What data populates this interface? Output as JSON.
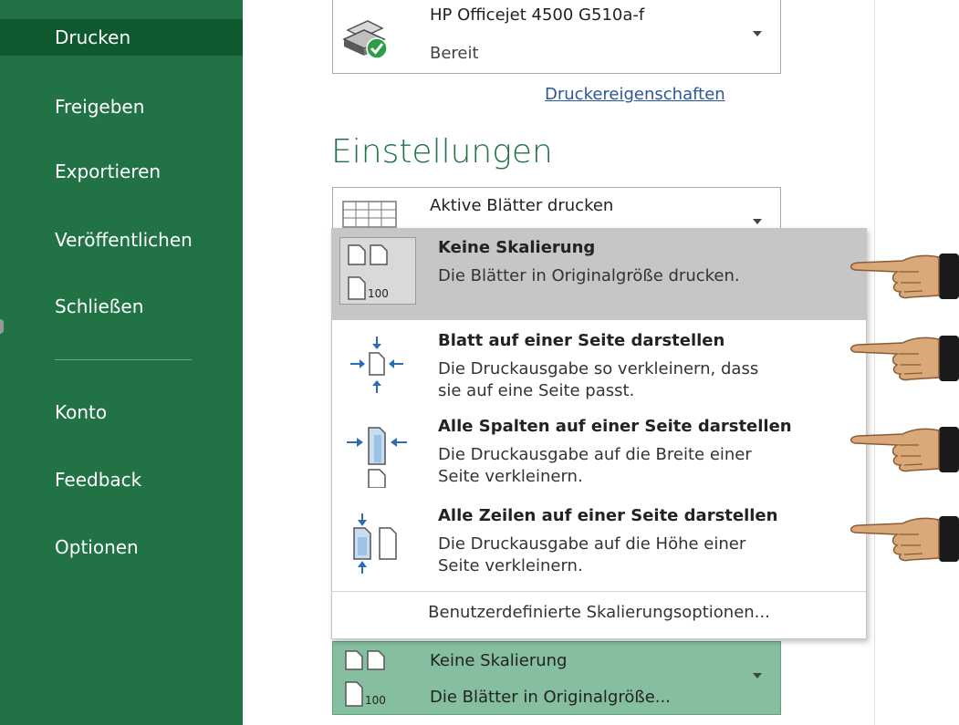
{
  "sidebar": {
    "items": [
      {
        "label": "Drucken",
        "active": true
      },
      {
        "label": "Freigeben"
      },
      {
        "label": "Exportieren"
      },
      {
        "label": "Veröffentlichen"
      },
      {
        "label": "Schließen"
      },
      {
        "label": "Konto"
      },
      {
        "label": "Feedback"
      },
      {
        "label": "Optionen"
      }
    ]
  },
  "printer": {
    "name": "HP Officejet 4500 G510a-f",
    "status": "Bereit",
    "icon": "printer-ready-icon",
    "properties_link": "Druckereigenschaften"
  },
  "settings": {
    "title": "Einstellungen",
    "sheets_selector": {
      "label": "Aktive Blätter drucken",
      "icon": "sheet-grid-icon"
    }
  },
  "scaling_menu": {
    "options": [
      {
        "title": "Keine Skalierung",
        "desc1": "Die Blätter in Originalgröße drucken.",
        "desc2": "",
        "icon": "no-scaling-icon",
        "icon_text": "100",
        "selected": true
      },
      {
        "title": "Blatt auf einer Seite darstellen",
        "desc1": "Die Druckausgabe so verkleinern, dass",
        "desc2": "sie auf eine Seite passt.",
        "icon": "fit-sheet-icon"
      },
      {
        "title": "Alle Spalten auf einer Seite darstellen",
        "desc1": "Die Druckausgabe auf die Breite einer",
        "desc2": "Seite verkleinern.",
        "icon": "fit-columns-icon"
      },
      {
        "title": "Alle Zeilen auf einer Seite darstellen",
        "desc1": "Die Druckausgabe auf die Höhe einer",
        "desc2": "Seite verkleinern.",
        "icon": "fit-rows-icon"
      }
    ],
    "custom_option": "Benutzerdefinierte Skalierungsoptionen..."
  },
  "scaling_selector": {
    "title": "Keine Skalierung",
    "desc": "Die Blätter in Originalgröße...",
    "icon": "no-scaling-icon",
    "icon_text": "100"
  },
  "colors": {
    "sidebar": "#217346",
    "sidebar_active": "#0e5a2e",
    "accent_text": "#217346",
    "selected_option": "#c6c6c6",
    "selector_highlight": "#86bf9f"
  }
}
